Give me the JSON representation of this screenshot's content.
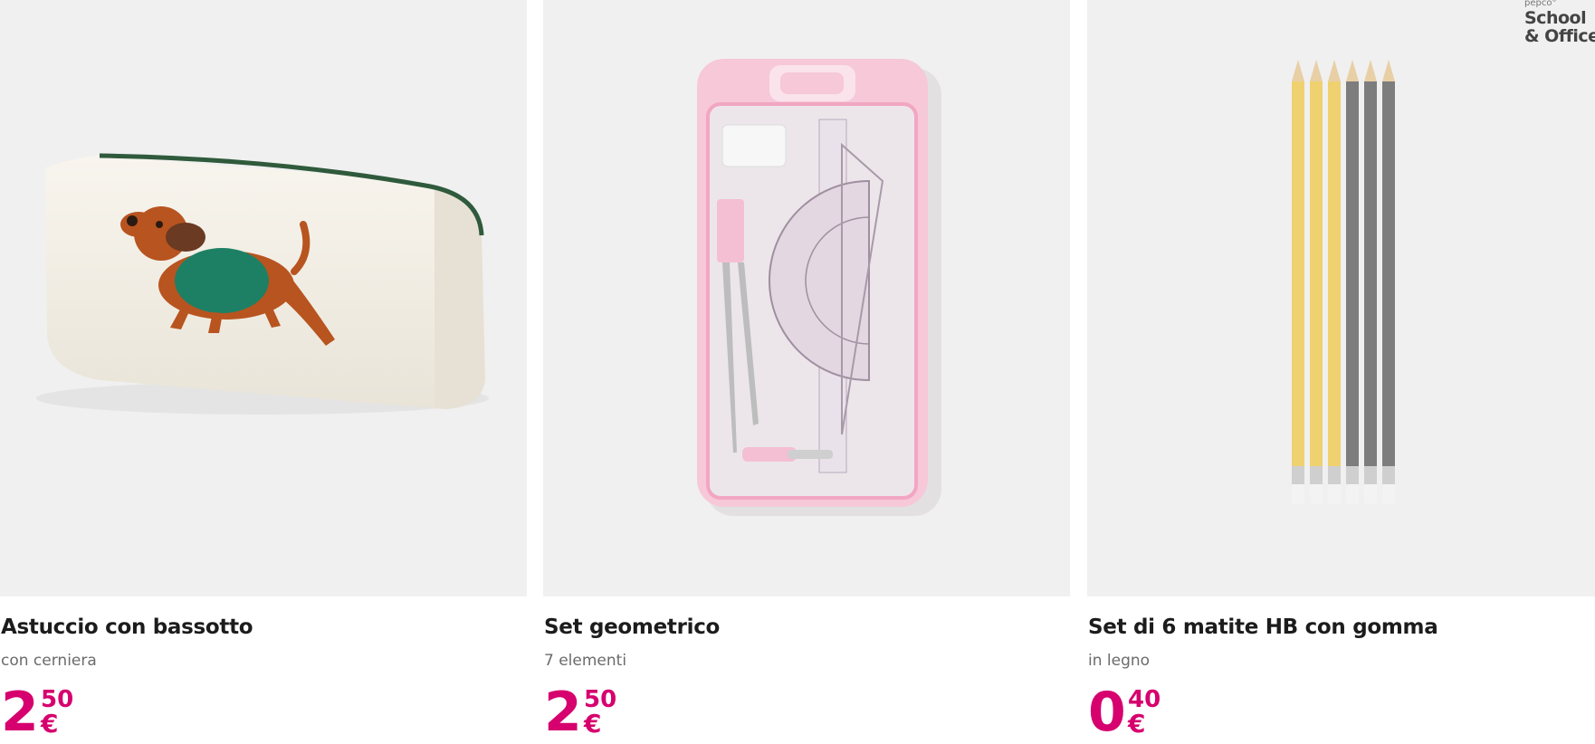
{
  "brand": {
    "small": "pepco°",
    "line1": "School",
    "line2": "& Office"
  },
  "colors": {
    "price": "#d6006e",
    "image_bg": "#f0f0f0",
    "subtitle": "#6b6b6b"
  },
  "products": [
    {
      "name": "Astuccio con bassotto",
      "subtitle": "con cerniera",
      "price_int": "2",
      "price_dec": "50",
      "currency": "€",
      "image": "pencil-case-dachshund-image"
    },
    {
      "name": "Set geometrico",
      "subtitle": "7 elementi",
      "price_int": "2",
      "price_dec": "50",
      "currency": "€",
      "image": "geometry-set-image"
    },
    {
      "name": "Set di 6 matite HB con gomma",
      "subtitle": "in legno",
      "price_int": "0",
      "price_dec": "40",
      "currency": "€",
      "image": "pencils-set-image"
    }
  ]
}
